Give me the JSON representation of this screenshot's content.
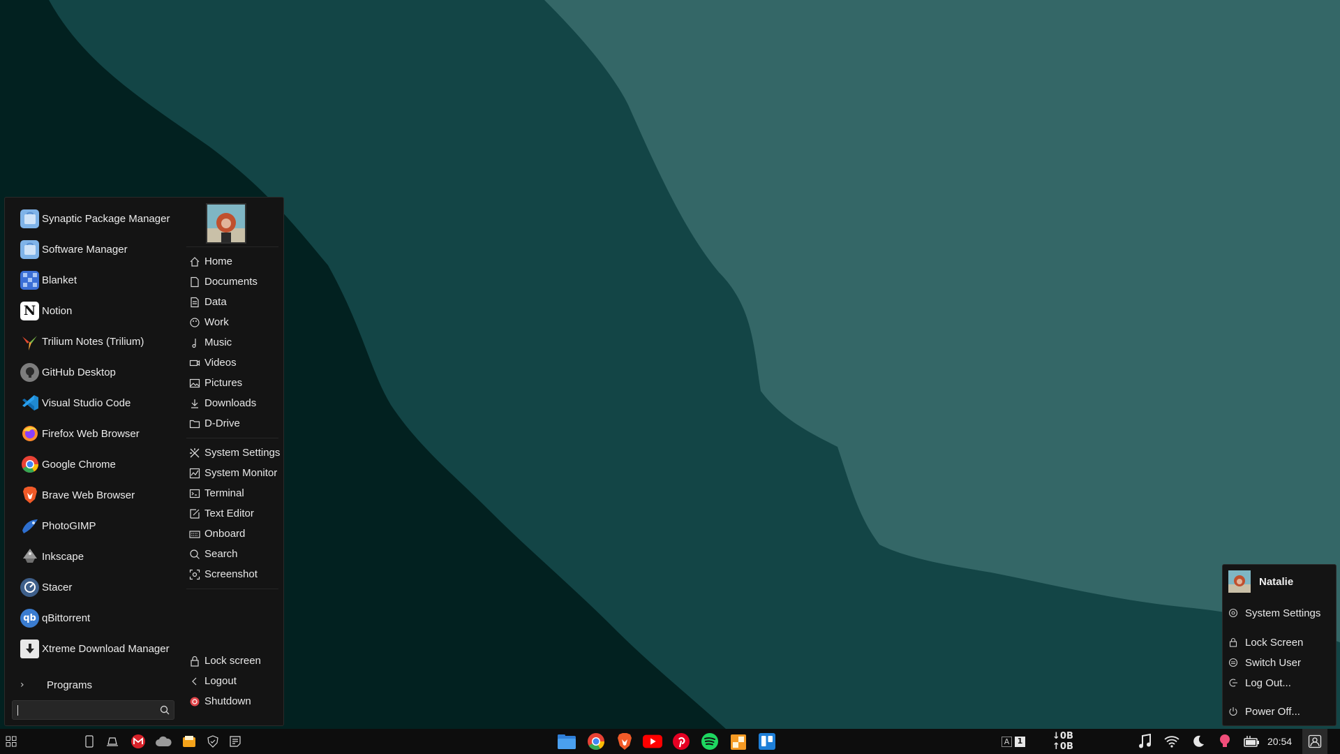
{
  "start_menu": {
    "apps": [
      {
        "label": "Synaptic Package Manager",
        "icon": "synaptic-icon",
        "color": "#7fb3e8"
      },
      {
        "label": "Software Manager",
        "icon": "software-manager-icon",
        "color": "#7fb3e8"
      },
      {
        "label": "Blanket",
        "icon": "blanket-icon",
        "color": "#3b6fd6"
      },
      {
        "label": "Notion",
        "icon": "notion-icon",
        "color": "#ffffff"
      },
      {
        "label": "Trilium Notes (Trilium)",
        "icon": "trilium-icon",
        "color": "#e24a2f"
      },
      {
        "label": "GitHub Desktop",
        "icon": "github-icon",
        "color": "#7d7d7d"
      },
      {
        "label": "Visual Studio Code",
        "icon": "vscode-icon",
        "color": "#1f8ad2"
      },
      {
        "label": "Firefox Web Browser",
        "icon": "firefox-icon",
        "color": "#ff6b2b"
      },
      {
        "label": "Google Chrome",
        "icon": "chrome-icon",
        "color": "#4a8bf5"
      },
      {
        "label": "Brave Web Browser",
        "icon": "brave-icon",
        "color": "#f05a28"
      },
      {
        "label": "PhotoGIMP",
        "icon": "photogimp-icon",
        "color": "#2e6fcf"
      },
      {
        "label": "Inkscape",
        "icon": "inkscape-icon",
        "color": "#9a9a9a"
      },
      {
        "label": "Stacer",
        "icon": "stacer-icon",
        "color": "#3e5f8a"
      },
      {
        "label": "qBittorrent",
        "icon": "qbittorrent-icon",
        "color": "#3a7cd0"
      },
      {
        "label": "Xtreme Download Manager",
        "icon": "xdm-icon",
        "color": "#e8e8e8"
      }
    ],
    "programs_label": "Programs",
    "search": {
      "value": "",
      "placeholder": ""
    },
    "places": [
      {
        "label": "Home",
        "icon": "home-icon"
      },
      {
        "label": "Documents",
        "icon": "document-icon"
      },
      {
        "label": "Data",
        "icon": "data-icon"
      },
      {
        "label": "Work",
        "icon": "work-icon"
      },
      {
        "label": "Music",
        "icon": "music-icon"
      },
      {
        "label": "Videos",
        "icon": "video-icon"
      },
      {
        "label": "Pictures",
        "icon": "pictures-icon"
      },
      {
        "label": "Downloads",
        "icon": "download-icon"
      },
      {
        "label": "D-Drive",
        "icon": "folder-icon"
      }
    ],
    "system": [
      {
        "label": "System Settings",
        "icon": "settings-icon"
      },
      {
        "label": "System Monitor",
        "icon": "monitor-icon"
      },
      {
        "label": "Terminal",
        "icon": "terminal-icon"
      },
      {
        "label": "Text Editor",
        "icon": "text-editor-icon"
      },
      {
        "label": "Onboard",
        "icon": "keyboard-icon"
      },
      {
        "label": "Search",
        "icon": "search-icon"
      },
      {
        "label": "Screenshot",
        "icon": "screenshot-icon"
      }
    ],
    "session": [
      {
        "label": "Lock screen",
        "icon": "lock-icon"
      },
      {
        "label": "Logout",
        "icon": "logout-icon"
      },
      {
        "label": "Shutdown",
        "icon": "shutdown-icon"
      }
    ]
  },
  "user_menu": {
    "name": "Natalie",
    "system_settings": "System Settings",
    "lock_screen": "Lock Screen",
    "switch_user": "Switch User",
    "log_out": "Log Out...",
    "power_off": "Power Off..."
  },
  "taskbar": {
    "net_down": "0B",
    "net_up": "0B",
    "kbd_indicator": "A",
    "workspace": "1",
    "clock": "20:54"
  },
  "colors": {
    "wallpaper_dark": "#022120",
    "wallpaper_mid": "#134546",
    "wallpaper_light": "#346767",
    "panel_bg": "#141414",
    "accent_shutdown": "#e0454a"
  }
}
